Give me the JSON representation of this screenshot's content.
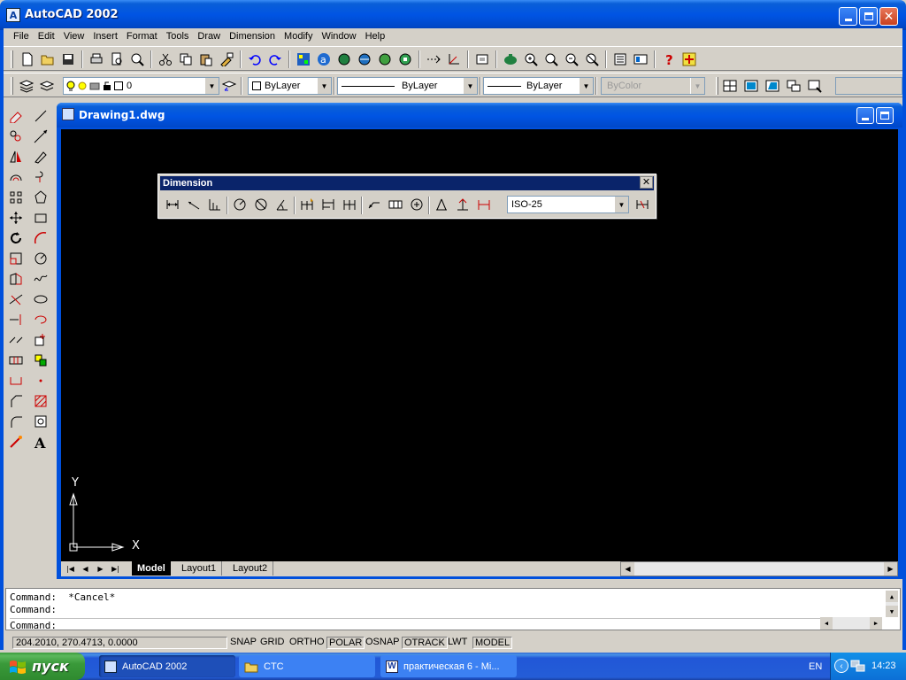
{
  "app": {
    "title": "AutoCAD 2002"
  },
  "menu": [
    "File",
    "Edit",
    "View",
    "Insert",
    "Format",
    "Tools",
    "Draw",
    "Dimension",
    "Modify",
    "Window",
    "Help"
  ],
  "layers_toolbar": {
    "layer_value": "0",
    "color_value": "ByLayer",
    "linetype_value": "ByLayer",
    "lineweight_value": "ByLayer",
    "plotstyle_value": "ByColor"
  },
  "drawing": {
    "title": "Drawing1.dwg",
    "ucs_x_label": "X",
    "ucs_y_label": "Y",
    "tabs": [
      "Model",
      "Layout1",
      "Layout2"
    ]
  },
  "dimension_toolbar": {
    "title": "Dimension",
    "close_label": "✕",
    "style_value": "ISO-25"
  },
  "command": {
    "lines": [
      "Command:  *Cancel*",
      "Command:",
      "Command:"
    ]
  },
  "status": {
    "coords": "204.2010, 270.4713, 0.0000",
    "buttons": [
      "SNAP",
      "GRID",
      "ORTHO",
      "POLAR",
      "OSNAP",
      "OTRACK",
      "LWT",
      "MODEL"
    ]
  },
  "taskbar": {
    "start_label": "пуск",
    "tasks": [
      "AutoCAD 2002",
      "CTC",
      "практическая 6 - Mi..."
    ],
    "language": "EN",
    "clock": "14:23"
  },
  "colors": {
    "xp_blue": "#0054e3",
    "canvas": "#000000",
    "face": "#d4d0c8"
  }
}
